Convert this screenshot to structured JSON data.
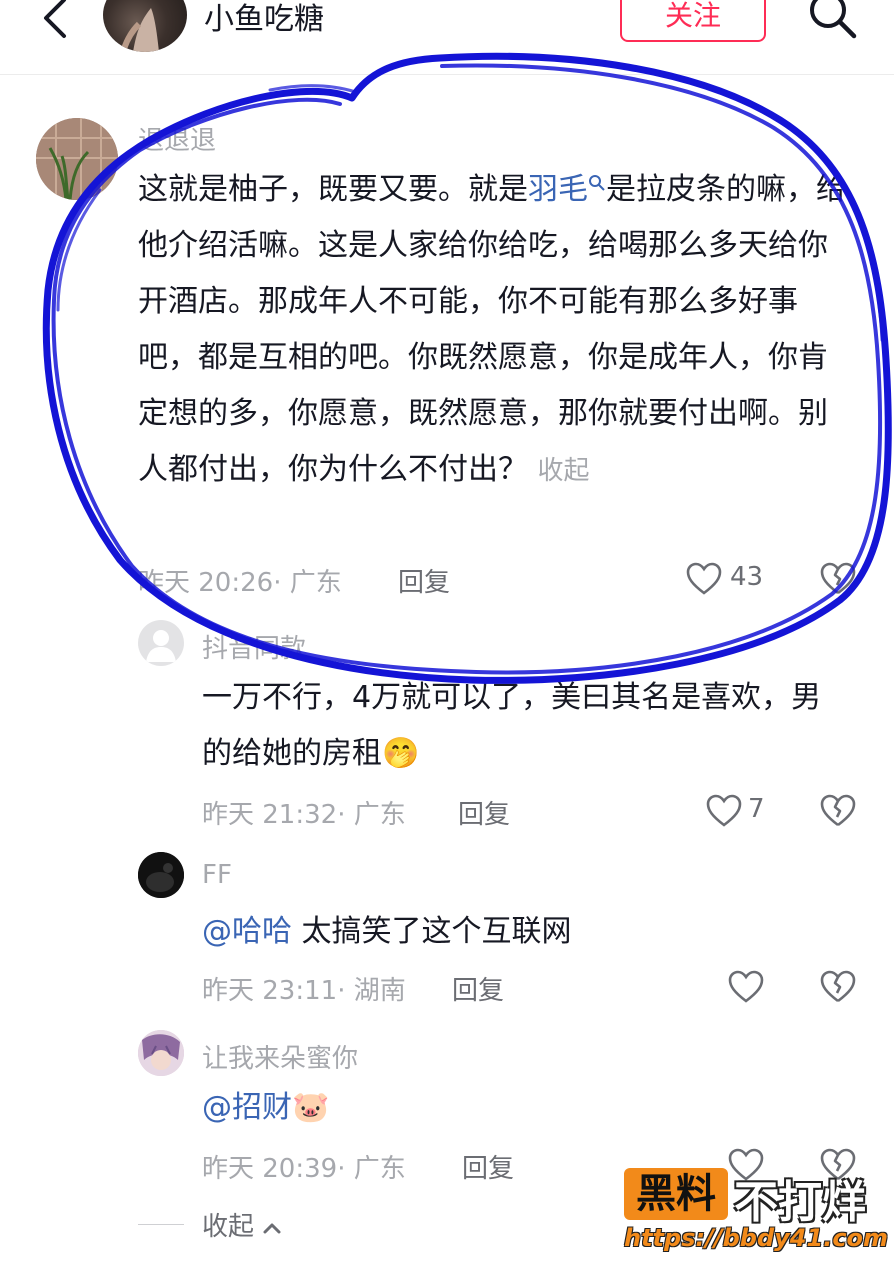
{
  "header": {
    "back_icon": "chevron-left-icon",
    "title": "小鱼吃糖",
    "follow_label": "关注",
    "search_icon": "search-icon"
  },
  "comments": [
    {
      "user": "退退退",
      "text_before": "这就是柚子，既要又要。就是",
      "link": "羽毛",
      "text_after": "是拉皮条的嘛，给他介绍活嘛。这是人家给你给吃，给喝那么多天给你开酒店。那成年人不可能，你不可能有那么多好事吧，都是互相的吧。你既然愿意，你是成年人，你肯定想的多，你愿意，既然愿意，那你就要付出啊。别人都付出，你为什么不付出？",
      "collapse_label": "收起",
      "meta": "昨天 20:26· 广东",
      "reply_label": "回复",
      "likes": "43"
    },
    {
      "user": "抖音同款",
      "text": "一万不行，4万就可以了，美曰其名是喜欢，男的给她的房租",
      "emoji": "🤭",
      "meta": "昨天 21:32· 广东",
      "reply_label": "回复",
      "likes": "7"
    },
    {
      "user": "FF",
      "mention": "@哈哈",
      "text": " 太搞笑了这个互联网",
      "meta": "昨天 23:11· 湖南",
      "reply_label": "回复"
    },
    {
      "user": "让我来朵蜜你",
      "mention": "@招财",
      "emoji": "🐷",
      "meta": "昨天 20:39· 广东",
      "reply_label": "回复"
    }
  ],
  "collapse_replies_label": "收起",
  "watermark": {
    "box": "黑料",
    "text": "不打烊",
    "url": "https://bbdy41.com"
  },
  "colors": {
    "accent": "#fe2c55",
    "link": "#3a65b4",
    "annotation": "#1414d6",
    "watermark": "#f28a1a"
  }
}
